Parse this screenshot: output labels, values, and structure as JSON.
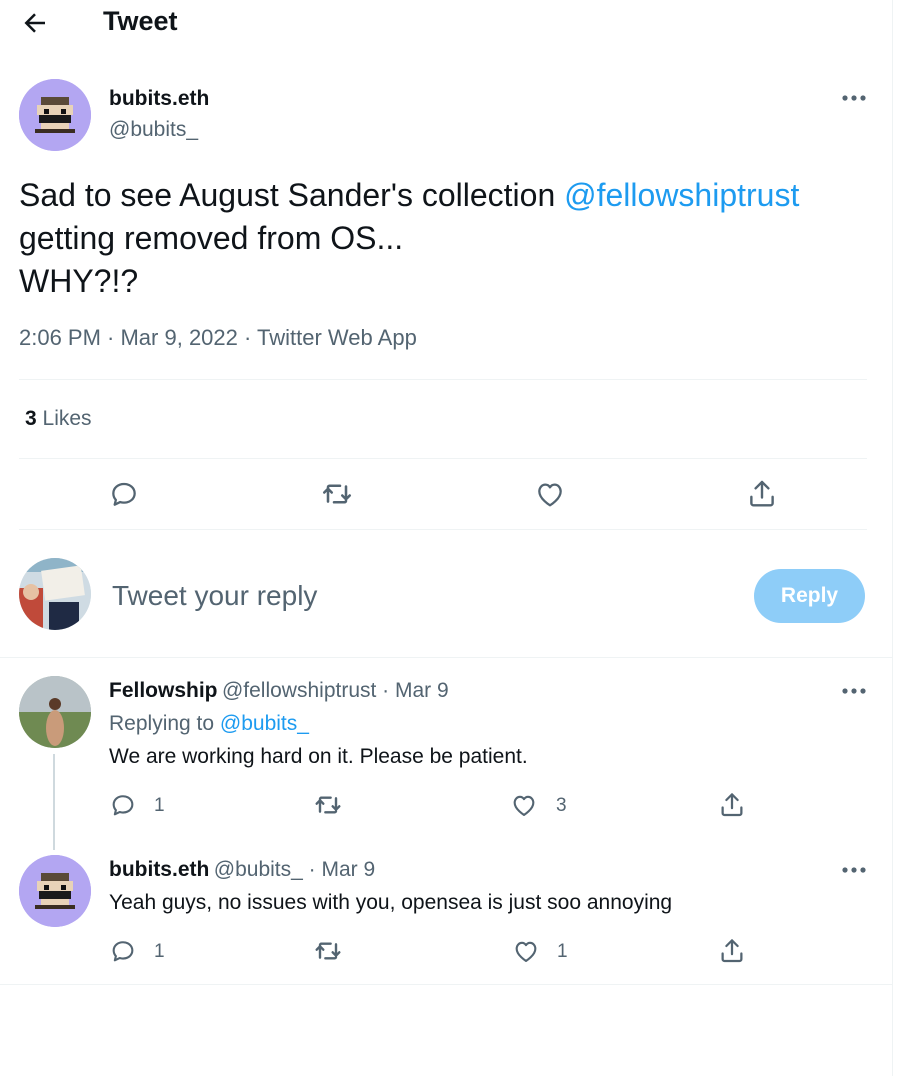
{
  "header": {
    "title": "Tweet"
  },
  "main_tweet": {
    "name": "bubits.eth",
    "handle": "@bubits_",
    "text_before": "Sad to see August Sander's collection ",
    "mention": "@fellowshiptrust",
    "text_line2": "getting removed from OS...",
    "text_line3": "WHY?!?",
    "meta": "2:06 PM · Mar 9, 2022 · Twitter Web App",
    "likes_count": "3",
    "likes_label": " Likes"
  },
  "composer": {
    "placeholder": "Tweet your reply",
    "reply_label": "Reply"
  },
  "replies": [
    {
      "name": "Fellowship",
      "handle": "@fellowshiptrust",
      "date": " · Mar 9",
      "replying_label": "Replying to ",
      "replying_to": "@bubits_",
      "text": "We are working hard on it. Please be patient.",
      "reply_count": "1",
      "like_count": "3"
    },
    {
      "name": "bubits.eth",
      "handle": "@bubits_",
      "date": " · Mar 9",
      "text": "Yeah guys, no issues with you, opensea is just soo annoying",
      "reply_count": "1",
      "like_count": "1"
    }
  ],
  "icons": {
    "back": "arrow-left-icon",
    "more": "more-dots-icon",
    "reply": "reply-bubble-icon",
    "retweet": "retweet-icon",
    "like": "heart-icon",
    "share": "share-icon"
  },
  "colors": {
    "accent": "#1d9bf0",
    "muted": "#536471",
    "reply_button": "#8ecdf8",
    "avatar_bg": "#b3a6f2"
  }
}
